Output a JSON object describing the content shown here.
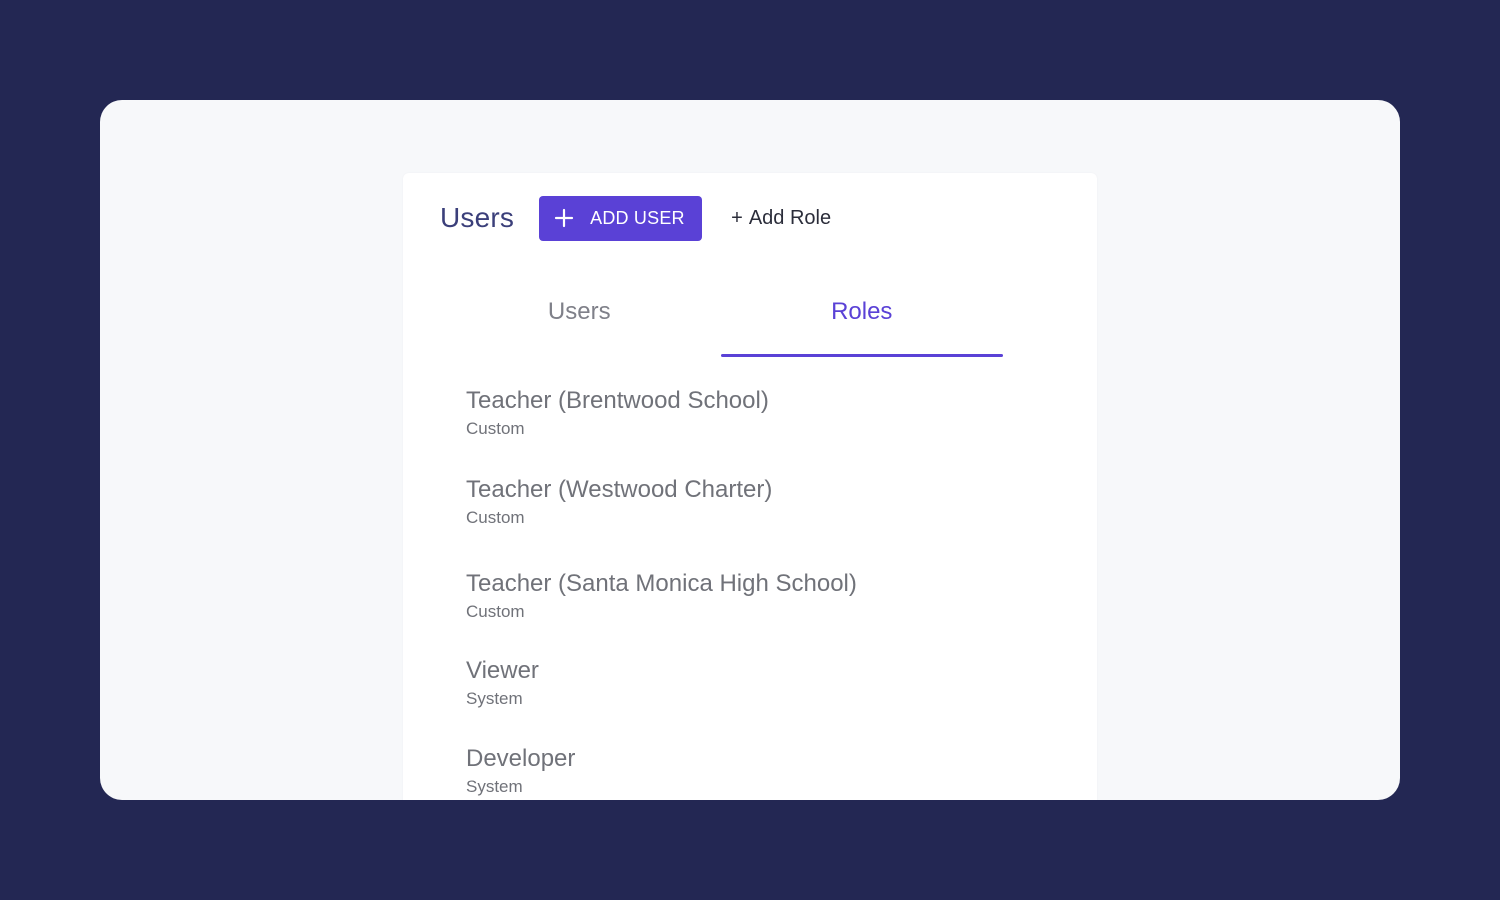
{
  "header": {
    "title": "Users",
    "add_user_button": {
      "label": "ADD USER",
      "icon": "plus-icon"
    },
    "add_role_link": {
      "prefix": "+",
      "label": "Add Role"
    }
  },
  "tabs": [
    {
      "label": "Users",
      "active": false
    },
    {
      "label": "Roles",
      "active": true
    }
  ],
  "roles": [
    {
      "name": "Teacher (Brentwood School)",
      "type": "Custom"
    },
    {
      "name": "Teacher (Westwood Charter)",
      "type": "Custom"
    },
    {
      "name": "Teacher (Santa Monica High School)",
      "type": "Custom"
    },
    {
      "name": "Viewer",
      "type": "System"
    },
    {
      "name": "Developer",
      "type": "System"
    }
  ],
  "colors": {
    "background": "#232753",
    "accent": "#5a41d6",
    "title": "#3b3f7a",
    "muted_text": "#707279"
  }
}
